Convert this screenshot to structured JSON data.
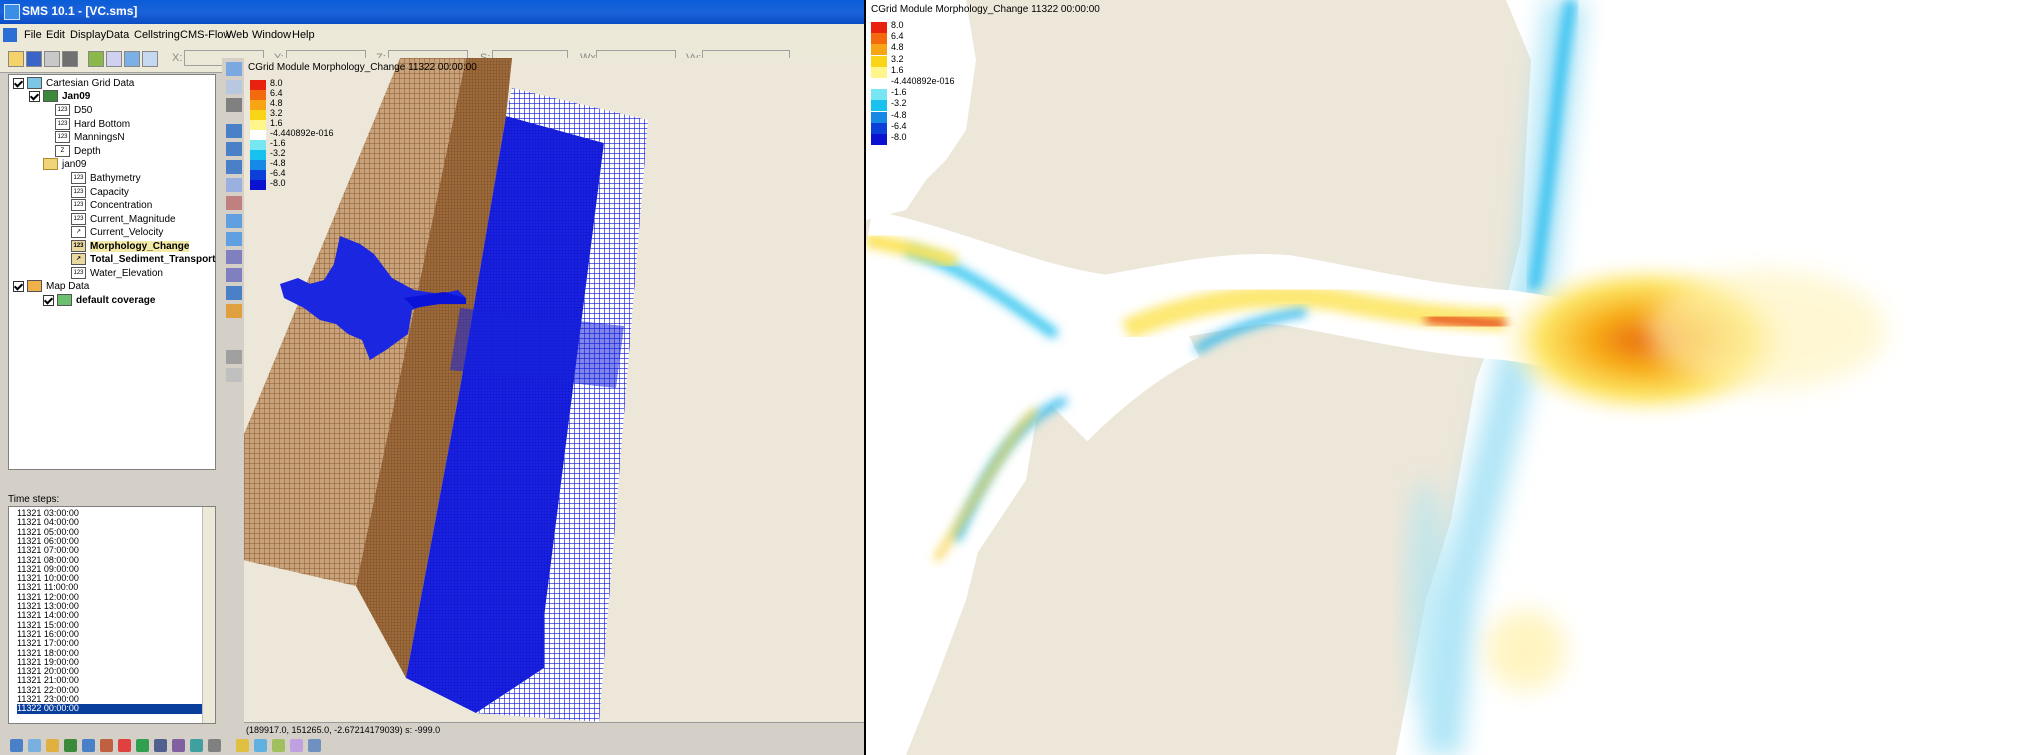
{
  "app": {
    "title": "SMS 10.1 - [VC.sms]",
    "menus": [
      "File",
      "Edit",
      "Display",
      "Data",
      "Cellstring",
      "CMS-Flow",
      "Web",
      "Window",
      "Help"
    ],
    "coord_labels": [
      "X:",
      "Y:",
      "Z:",
      "S:",
      "Wx:",
      "Vy:"
    ]
  },
  "tree": {
    "items": [
      {
        "label": "Cartesian Grid Data",
        "bold": false
      },
      {
        "label": "Jan09",
        "bold": true
      },
      {
        "label": "D50",
        "bold": false
      },
      {
        "label": "Hard Bottom",
        "bold": false
      },
      {
        "label": "ManningsN",
        "bold": false
      },
      {
        "label": "Depth",
        "bold": false
      },
      {
        "label": "jan09",
        "bold": false
      },
      {
        "label": "Bathymetry",
        "bold": false
      },
      {
        "label": "Capacity",
        "bold": false
      },
      {
        "label": "Concentration",
        "bold": false
      },
      {
        "label": "Current_Magnitude",
        "bold": false
      },
      {
        "label": "Current_Velocity",
        "bold": false
      },
      {
        "label": "Morphology_Change",
        "bold": true
      },
      {
        "label": "Total_Sediment_Transport",
        "bold": true
      },
      {
        "label": "Water_Elevation",
        "bold": false
      },
      {
        "label": "Map Data",
        "bold": false
      },
      {
        "label": "default coverage",
        "bold": true
      }
    ]
  },
  "timesteps": {
    "label": "Time steps:",
    "items": [
      "11321 03:00:00",
      "11321 04:00:00",
      "11321 05:00:00",
      "11321 06:00:00",
      "11321 07:00:00",
      "11321 08:00:00",
      "11321 09:00:00",
      "11321 10:00:00",
      "11321 11:00:00",
      "11321 12:00:00",
      "11321 13:00:00",
      "11321 14:00:00",
      "11321 15:00:00",
      "11321 16:00:00",
      "11321 17:00:00",
      "11321 18:00:00",
      "11321 19:00:00",
      "11321 20:00:00",
      "11321 21:00:00",
      "11321 22:00:00",
      "11321 23:00:00",
      "11322 00:00:00"
    ],
    "selected": "11322 00:00:00"
  },
  "view": {
    "title": "CGrid Module Morphology_Change 11322 00:00:00"
  },
  "legend": {
    "entries": [
      {
        "label": "8.0",
        "color": "#e8220e"
      },
      {
        "label": "6.4",
        "color": "#f26a0d"
      },
      {
        "label": "4.8",
        "color": "#f7a515"
      },
      {
        "label": "3.2",
        "color": "#f8d516"
      },
      {
        "label": "1.6",
        "color": "#fff58a"
      },
      {
        "label": "-4.440892e-016",
        "color": "#ffffff"
      },
      {
        "label": "-1.6",
        "color": "#75e6f2"
      },
      {
        "label": "-3.2",
        "color": "#19c1ee"
      },
      {
        "label": "-4.8",
        "color": "#1688e6"
      },
      {
        "label": "-6.4",
        "color": "#0c3fd8"
      },
      {
        "label": "-8.0",
        "color": "#0a12d0"
      }
    ]
  },
  "status_text": "(189917.0, 151265.0, -2.67214179039) s: -999.0",
  "right_view": {
    "title": "CGrid Module Morphology_Change 11322 00:00:00"
  },
  "colors": {
    "land": "#a5713f",
    "water": "#0a12d8",
    "background": "#ede7d9",
    "titlebar": "#0b5dd7"
  }
}
